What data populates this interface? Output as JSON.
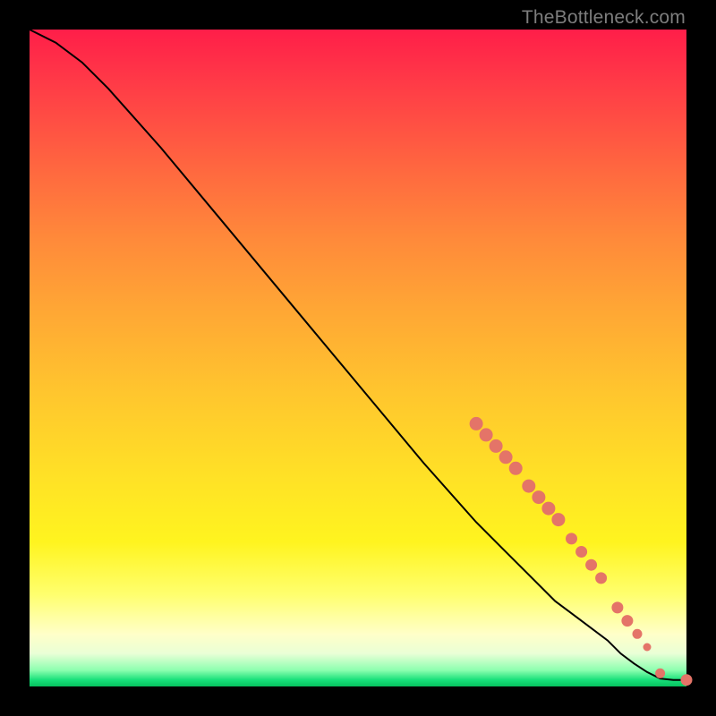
{
  "watermark": "TheBottleneck.com",
  "colors": {
    "curve_stroke": "#000000",
    "marker_fill": "#e47468",
    "marker_stroke": "#e47468"
  },
  "chart_data": {
    "type": "line",
    "title": "",
    "xlabel": "",
    "ylabel": "",
    "xlim": [
      0,
      100
    ],
    "ylim": [
      0,
      100
    ],
    "grid": false,
    "legend": false,
    "series": [
      {
        "name": "curve",
        "x": [
          0,
          4,
          8,
          12,
          20,
          30,
          40,
          50,
          60,
          68,
          72,
          76,
          80,
          84,
          88,
          90,
          92,
          94,
          96,
          98,
          100
        ],
        "y": [
          100,
          98,
          95,
          91,
          82,
          70,
          58,
          46,
          34,
          25,
          21,
          17,
          13,
          10,
          7,
          5,
          3.5,
          2.2,
          1.2,
          1.0,
          1.0
        ]
      }
    ],
    "markers": [
      {
        "x": 68,
        "y": 40,
        "r": 7
      },
      {
        "x": 69.5,
        "y": 38.3,
        "r": 7
      },
      {
        "x": 71,
        "y": 36.6,
        "r": 7
      },
      {
        "x": 72.5,
        "y": 34.9,
        "r": 7
      },
      {
        "x": 74,
        "y": 33.2,
        "r": 7
      },
      {
        "x": 76,
        "y": 30.5,
        "r": 7
      },
      {
        "x": 77.5,
        "y": 28.8,
        "r": 7
      },
      {
        "x": 79,
        "y": 27.1,
        "r": 7
      },
      {
        "x": 80.5,
        "y": 25.4,
        "r": 7
      },
      {
        "x": 82.5,
        "y": 22.5,
        "r": 6
      },
      {
        "x": 84,
        "y": 20.5,
        "r": 6
      },
      {
        "x": 85.5,
        "y": 18.5,
        "r": 6
      },
      {
        "x": 87,
        "y": 16.5,
        "r": 6
      },
      {
        "x": 89.5,
        "y": 12,
        "r": 6
      },
      {
        "x": 91,
        "y": 10,
        "r": 6
      },
      {
        "x": 92.5,
        "y": 8,
        "r": 5
      },
      {
        "x": 94,
        "y": 6,
        "r": 4
      },
      {
        "x": 96,
        "y": 2,
        "r": 5
      },
      {
        "x": 100,
        "y": 1,
        "r": 6
      }
    ]
  }
}
